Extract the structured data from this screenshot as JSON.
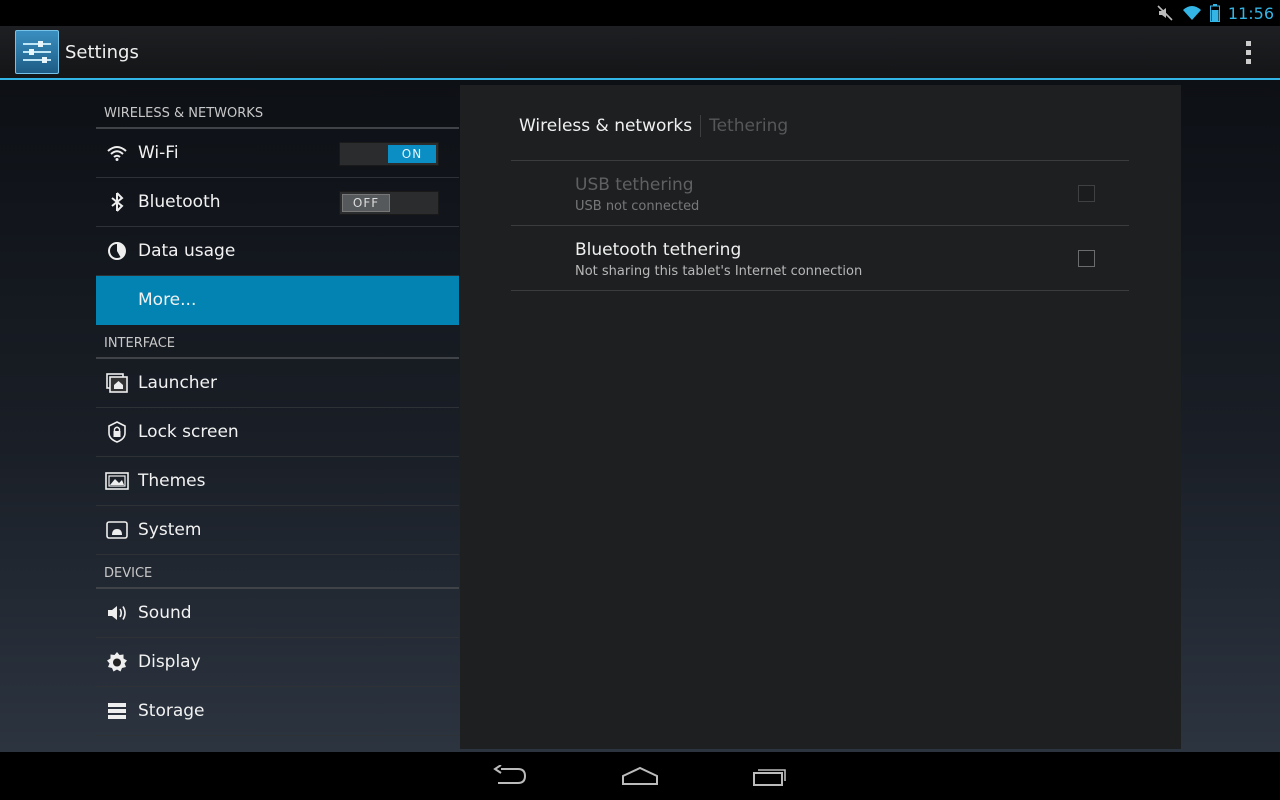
{
  "status_bar": {
    "time": "11:56",
    "icons": [
      "mute-icon",
      "wifi-icon",
      "battery-icon"
    ]
  },
  "action_bar": {
    "title": "Settings",
    "app_icon": "settings-sliders-icon",
    "overflow_icon": "overflow-menu-icon"
  },
  "sidebar": {
    "sections": [
      {
        "header": "WIRELESS & NETWORKS",
        "items": [
          {
            "label": "Wi-Fi",
            "icon": "wifi-icon",
            "toggle": "ON"
          },
          {
            "label": "Bluetooth",
            "icon": "bluetooth-icon",
            "toggle": "OFF"
          },
          {
            "label": "Data usage",
            "icon": "data-usage-icon"
          },
          {
            "label": "More...",
            "icon": "",
            "selected": true
          }
        ]
      },
      {
        "header": "INTERFACE",
        "items": [
          {
            "label": "Launcher",
            "icon": "launcher-icon"
          },
          {
            "label": "Lock screen",
            "icon": "lock-icon"
          },
          {
            "label": "Themes",
            "icon": "themes-icon"
          },
          {
            "label": "System",
            "icon": "system-icon"
          }
        ]
      },
      {
        "header": "DEVICE",
        "items": [
          {
            "label": "Sound",
            "icon": "speaker-icon"
          },
          {
            "label": "Display",
            "icon": "brightness-icon"
          },
          {
            "label": "Storage",
            "icon": "storage-icon"
          }
        ]
      }
    ]
  },
  "main": {
    "tabs": [
      {
        "label": "Wireless & networks",
        "active": true
      },
      {
        "label": "Tethering",
        "active": false
      }
    ],
    "prefs": [
      {
        "title": "USB tethering",
        "summary": "USB not connected",
        "enabled": false,
        "checked": false
      },
      {
        "title": "Bluetooth tethering",
        "summary": "Not sharing this tablet's Internet connection",
        "enabled": true,
        "checked": false
      }
    ]
  },
  "nav_bar": {
    "buttons": [
      "back-icon",
      "home-icon",
      "recent-apps-icon"
    ]
  },
  "colors": {
    "accent": "#33b5e5",
    "selected": "#0383b1",
    "toggle_on": "#0a8ec4"
  }
}
